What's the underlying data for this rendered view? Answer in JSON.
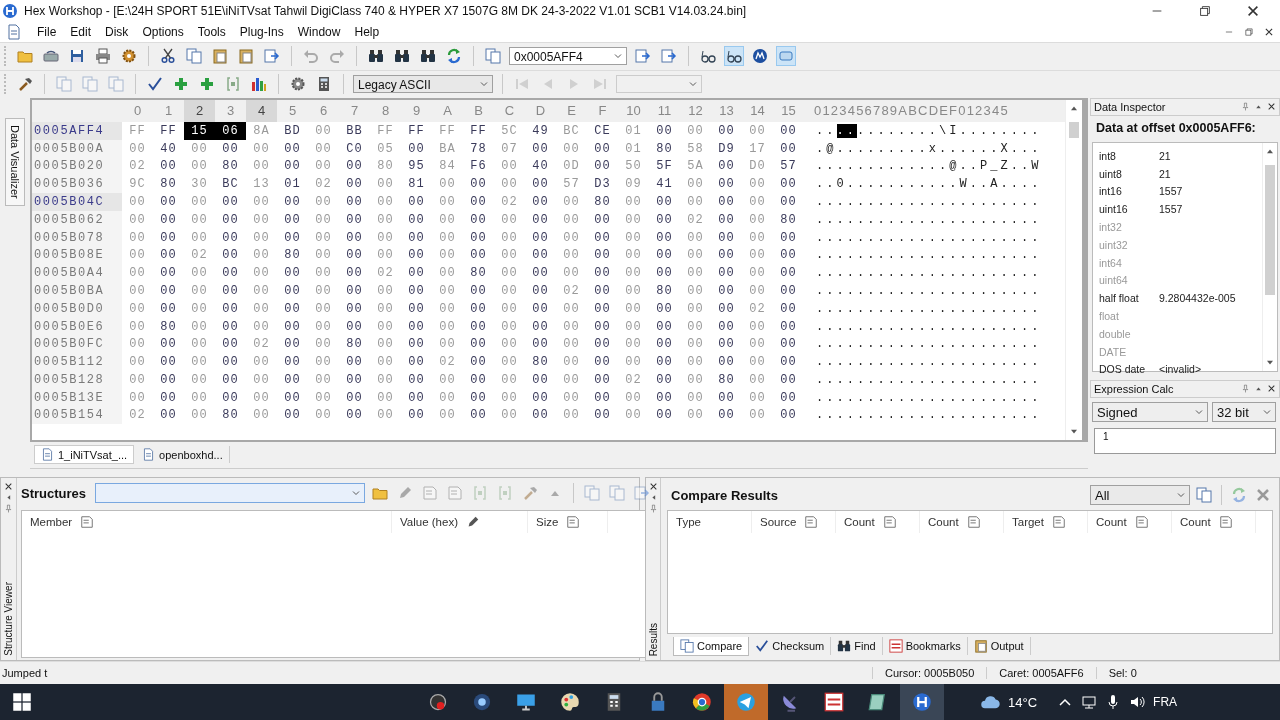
{
  "window": {
    "title": "Hex Workshop - [E:\\24H SPORT 51E\\iNiTVsat Tahwil DigiClass 740 & HYPER X7 1507G 8M DK 24-3-2022 V1.01 SCB1 V14.03.24.bin]"
  },
  "menu": [
    "File",
    "Edit",
    "Disk",
    "Options",
    "Tools",
    "Plug-Ins",
    "Window",
    "Help"
  ],
  "toolbar": {
    "address": "0x0005AFF4",
    "encoding": "Legacy ASCII"
  },
  "left_side_tab": "Data Visualizer",
  "hex_view": {
    "ascii_header": "0123456789ABCDEF012345",
    "columns": [
      {
        "label": "0",
        "highlighted": false
      },
      {
        "label": "1",
        "highlighted": false
      },
      {
        "label": "2",
        "highlighted": true
      },
      {
        "label": "3",
        "highlighted": false
      },
      {
        "label": "4",
        "highlighted": true
      },
      {
        "label": "5",
        "highlighted": false
      },
      {
        "label": "6",
        "highlighted": false
      },
      {
        "label": "7",
        "highlighted": false
      },
      {
        "label": "8",
        "highlighted": false
      },
      {
        "label": "9",
        "highlighted": false
      },
      {
        "label": "A",
        "highlighted": false
      },
      {
        "label": "B",
        "highlighted": false
      },
      {
        "label": "C",
        "highlighted": false
      },
      {
        "label": "D",
        "highlighted": false
      },
      {
        "label": "E",
        "highlighted": false
      },
      {
        "label": "F",
        "highlighted": false
      },
      {
        "label": "10",
        "highlighted": false
      },
      {
        "label": "11",
        "highlighted": false
      },
      {
        "label": "12",
        "highlighted": false
      },
      {
        "label": "13",
        "highlighted": false
      },
      {
        "label": "14",
        "highlighted": false
      },
      {
        "label": "15",
        "highlighted": false
      }
    ],
    "rows": [
      {
        "offset": "0005AFF4",
        "highlighted": true,
        "bytes": [
          "FF",
          "FF",
          "15",
          "06",
          "8A",
          "BD",
          "00",
          "BB",
          "FF",
          "FF",
          "FF",
          "FF",
          "5C",
          "49",
          "BC",
          "CE",
          "01",
          "00",
          "00",
          "00",
          "00",
          "00"
        ],
        "selected": [
          false,
          false,
          true,
          true,
          false,
          false,
          false,
          false,
          false,
          false,
          false,
          false,
          false,
          false,
          false,
          false,
          false,
          false,
          false,
          false,
          false,
          false
        ],
        "ascii": "............\\I........"
      },
      {
        "offset": "0005B00A",
        "highlighted": false,
        "bytes": [
          "00",
          "40",
          "00",
          "00",
          "00",
          "00",
          "00",
          "C0",
          "05",
          "00",
          "BA",
          "78",
          "07",
          "00",
          "00",
          "00",
          "01",
          "80",
          "58",
          "D9",
          "17",
          "00"
        ],
        "selected": [
          false,
          false,
          false,
          false,
          false,
          false,
          false,
          false,
          false,
          false,
          false,
          false,
          false,
          false,
          false,
          false,
          false,
          false,
          false,
          false,
          false,
          false
        ],
        "ascii": ".@.........x......X..."
      },
      {
        "offset": "0005B020",
        "highlighted": false,
        "bytes": [
          "02",
          "00",
          "00",
          "80",
          "00",
          "00",
          "00",
          "00",
          "80",
          "95",
          "84",
          "F6",
          "00",
          "40",
          "0D",
          "00",
          "50",
          "5F",
          "5A",
          "00",
          "D0",
          "57"
        ],
        "selected": [
          false,
          false,
          false,
          false,
          false,
          false,
          false,
          false,
          false,
          false,
          false,
          false,
          false,
          false,
          false,
          false,
          false,
          false,
          false,
          false,
          false,
          false
        ],
        "ascii": ".............@..P_Z..W"
      },
      {
        "offset": "0005B036",
        "highlighted": false,
        "bytes": [
          "9C",
          "80",
          "30",
          "BC",
          "13",
          "01",
          "02",
          "00",
          "00",
          "81",
          "00",
          "00",
          "00",
          "00",
          "57",
          "D3",
          "09",
          "41",
          "00",
          "00",
          "00",
          "00"
        ],
        "selected": [
          false,
          false,
          false,
          false,
          false,
          false,
          false,
          false,
          false,
          false,
          false,
          false,
          false,
          false,
          false,
          false,
          false,
          false,
          false,
          false,
          false,
          false
        ],
        "ascii": "..0...........W..A...."
      },
      {
        "offset": "0005B04C",
        "highlighted": true,
        "bytes": [
          "00",
          "00",
          "00",
          "00",
          "00",
          "00",
          "00",
          "00",
          "00",
          "00",
          "00",
          "00",
          "02",
          "00",
          "00",
          "80",
          "00",
          "00",
          "00",
          "00",
          "00",
          "00"
        ],
        "selected": [
          false,
          false,
          false,
          false,
          false,
          false,
          false,
          false,
          false,
          false,
          false,
          false,
          false,
          false,
          false,
          false,
          false,
          false,
          false,
          false,
          false,
          false
        ],
        "ascii": "......................"
      },
      {
        "offset": "0005B062",
        "highlighted": false,
        "bytes": [
          "00",
          "00",
          "00",
          "00",
          "00",
          "00",
          "00",
          "00",
          "00",
          "00",
          "00",
          "00",
          "00",
          "00",
          "00",
          "00",
          "00",
          "00",
          "02",
          "00",
          "00",
          "80"
        ],
        "selected": [
          false,
          false,
          false,
          false,
          false,
          false,
          false,
          false,
          false,
          false,
          false,
          false,
          false,
          false,
          false,
          false,
          false,
          false,
          false,
          false,
          false,
          false
        ],
        "ascii": "......................"
      },
      {
        "offset": "0005B078",
        "highlighted": false,
        "bytes": [
          "00",
          "00",
          "00",
          "00",
          "00",
          "00",
          "00",
          "00",
          "00",
          "00",
          "00",
          "00",
          "00",
          "00",
          "00",
          "00",
          "00",
          "00",
          "00",
          "00",
          "00",
          "00"
        ],
        "selected": [
          false,
          false,
          false,
          false,
          false,
          false,
          false,
          false,
          false,
          false,
          false,
          false,
          false,
          false,
          false,
          false,
          false,
          false,
          false,
          false,
          false,
          false
        ],
        "ascii": "......................"
      },
      {
        "offset": "0005B08E",
        "highlighted": false,
        "bytes": [
          "00",
          "00",
          "02",
          "00",
          "00",
          "80",
          "00",
          "00",
          "00",
          "00",
          "00",
          "00",
          "00",
          "00",
          "00",
          "00",
          "00",
          "00",
          "00",
          "00",
          "00",
          "00"
        ],
        "selected": [
          false,
          false,
          false,
          false,
          false,
          false,
          false,
          false,
          false,
          false,
          false,
          false,
          false,
          false,
          false,
          false,
          false,
          false,
          false,
          false,
          false,
          false
        ],
        "ascii": "......................"
      },
      {
        "offset": "0005B0A4",
        "highlighted": false,
        "bytes": [
          "00",
          "00",
          "00",
          "00",
          "00",
          "00",
          "00",
          "00",
          "02",
          "00",
          "00",
          "80",
          "00",
          "00",
          "00",
          "00",
          "00",
          "00",
          "00",
          "00",
          "00",
          "00"
        ],
        "selected": [
          false,
          false,
          false,
          false,
          false,
          false,
          false,
          false,
          false,
          false,
          false,
          false,
          false,
          false,
          false,
          false,
          false,
          false,
          false,
          false,
          false,
          false
        ],
        "ascii": "......................"
      },
      {
        "offset": "0005B0BA",
        "highlighted": false,
        "bytes": [
          "00",
          "00",
          "00",
          "00",
          "00",
          "00",
          "00",
          "00",
          "00",
          "00",
          "00",
          "00",
          "00",
          "00",
          "02",
          "00",
          "00",
          "80",
          "00",
          "00",
          "00",
          "00"
        ],
        "selected": [
          false,
          false,
          false,
          false,
          false,
          false,
          false,
          false,
          false,
          false,
          false,
          false,
          false,
          false,
          false,
          false,
          false,
          false,
          false,
          false,
          false,
          false
        ],
        "ascii": "......................"
      },
      {
        "offset": "0005B0D0",
        "highlighted": false,
        "bytes": [
          "00",
          "00",
          "00",
          "00",
          "00",
          "00",
          "00",
          "00",
          "00",
          "00",
          "00",
          "00",
          "00",
          "00",
          "00",
          "00",
          "00",
          "00",
          "00",
          "00",
          "02",
          "00"
        ],
        "selected": [
          false,
          false,
          false,
          false,
          false,
          false,
          false,
          false,
          false,
          false,
          false,
          false,
          false,
          false,
          false,
          false,
          false,
          false,
          false,
          false,
          false,
          false
        ],
        "ascii": "......................"
      },
      {
        "offset": "0005B0E6",
        "highlighted": false,
        "bytes": [
          "00",
          "80",
          "00",
          "00",
          "00",
          "00",
          "00",
          "00",
          "00",
          "00",
          "00",
          "00",
          "00",
          "00",
          "00",
          "00",
          "00",
          "00",
          "00",
          "00",
          "00",
          "00"
        ],
        "selected": [
          false,
          false,
          false,
          false,
          false,
          false,
          false,
          false,
          false,
          false,
          false,
          false,
          false,
          false,
          false,
          false,
          false,
          false,
          false,
          false,
          false,
          false
        ],
        "ascii": "......................"
      },
      {
        "offset": "0005B0FC",
        "highlighted": false,
        "bytes": [
          "00",
          "00",
          "00",
          "00",
          "02",
          "00",
          "00",
          "80",
          "00",
          "00",
          "00",
          "00",
          "00",
          "00",
          "00",
          "00",
          "00",
          "00",
          "00",
          "00",
          "00",
          "00"
        ],
        "selected": [
          false,
          false,
          false,
          false,
          false,
          false,
          false,
          false,
          false,
          false,
          false,
          false,
          false,
          false,
          false,
          false,
          false,
          false,
          false,
          false,
          false,
          false
        ],
        "ascii": "......................"
      },
      {
        "offset": "0005B112",
        "highlighted": false,
        "bytes": [
          "00",
          "00",
          "00",
          "00",
          "00",
          "00",
          "00",
          "00",
          "00",
          "00",
          "02",
          "00",
          "00",
          "80",
          "00",
          "00",
          "00",
          "00",
          "00",
          "00",
          "00",
          "00"
        ],
        "selected": [
          false,
          false,
          false,
          false,
          false,
          false,
          false,
          false,
          false,
          false,
          false,
          false,
          false,
          false,
          false,
          false,
          false,
          false,
          false,
          false,
          false,
          false
        ],
        "ascii": "......................"
      },
      {
        "offset": "0005B128",
        "highlighted": false,
        "bytes": [
          "00",
          "00",
          "00",
          "00",
          "00",
          "00",
          "00",
          "00",
          "00",
          "00",
          "00",
          "00",
          "00",
          "00",
          "00",
          "00",
          "02",
          "00",
          "00",
          "80",
          "00",
          "00"
        ],
        "selected": [
          false,
          false,
          false,
          false,
          false,
          false,
          false,
          false,
          false,
          false,
          false,
          false,
          false,
          false,
          false,
          false,
          false,
          false,
          false,
          false,
          false,
          false
        ],
        "ascii": "......................"
      },
      {
        "offset": "0005B13E",
        "highlighted": false,
        "bytes": [
          "00",
          "00",
          "00",
          "00",
          "00",
          "00",
          "00",
          "00",
          "00",
          "00",
          "00",
          "00",
          "00",
          "00",
          "00",
          "00",
          "00",
          "00",
          "00",
          "00",
          "00",
          "00"
        ],
        "selected": [
          false,
          false,
          false,
          false,
          false,
          false,
          false,
          false,
          false,
          false,
          false,
          false,
          false,
          false,
          false,
          false,
          false,
          false,
          false,
          false,
          false,
          false
        ],
        "ascii": "......................"
      },
      {
        "offset": "0005B154",
        "highlighted": false,
        "bytes": [
          "02",
          "00",
          "00",
          "80",
          "00",
          "00",
          "00",
          "00",
          "00",
          "00",
          "00",
          "00",
          "00",
          "00",
          "00",
          "00",
          "00",
          "00",
          "00",
          "00",
          "00",
          "00"
        ],
        "selected": [
          false,
          false,
          false,
          false,
          false,
          false,
          false,
          false,
          false,
          false,
          false,
          false,
          false,
          false,
          false,
          false,
          false,
          false,
          false,
          false,
          false,
          false
        ],
        "ascii": "......................"
      }
    ]
  },
  "document_tabs": [
    {
      "label": "1_iNiTVsat_...",
      "selected": true
    },
    {
      "label": "openboxhd...",
      "selected": false
    }
  ],
  "data_inspector": {
    "title": "Data Inspector",
    "heading": "Data at offset 0x0005AFF6:",
    "rows": [
      {
        "type": "int8",
        "value": "21",
        "disabled": false
      },
      {
        "type": "uint8",
        "value": "21",
        "disabled": false
      },
      {
        "type": "int16",
        "value": "1557",
        "disabled": false
      },
      {
        "type": "uint16",
        "value": "1557",
        "disabled": false
      },
      {
        "type": "int32",
        "disabled": true
      },
      {
        "type": "uint32",
        "disabled": true
      },
      {
        "type": "int64",
        "disabled": true
      },
      {
        "type": "uint64",
        "disabled": true
      },
      {
        "type": "half float",
        "value": "9.2804432e-005",
        "disabled": false
      },
      {
        "type": "float",
        "disabled": true
      },
      {
        "type": "double",
        "disabled": true
      },
      {
        "type": "DATE",
        "disabled": true
      },
      {
        "type": "DOS date",
        "value": "<invalid>",
        "disabled": false
      }
    ]
  },
  "expression_calc": {
    "title": "Expression Calc",
    "mode": "Signed",
    "width": "32 bit",
    "expression": "1"
  },
  "structures": {
    "title": "Structures",
    "side_label": "Structure Viewer",
    "columns": [
      "Member",
      "Value (hex)",
      "Size"
    ]
  },
  "compare_results": {
    "title": "Compare Results",
    "side_label": "Results",
    "filter": "All",
    "columns": [
      "Type",
      "Source",
      "Count",
      "Count",
      "Target",
      "Count",
      "Count"
    ],
    "tabs": [
      {
        "label": "Compare",
        "selected": true
      },
      {
        "label": "Checksum",
        "selected": false
      },
      {
        "label": "Find",
        "selected": false
      },
      {
        "label": "Bookmarks",
        "selected": false
      },
      {
        "label": "Output",
        "selected": false
      }
    ]
  },
  "status_bar": {
    "message": "Jumped t",
    "cursor": "Cursor: 0005B050",
    "caret": "Caret: 0005AFF6",
    "selection": "Sel: 0"
  },
  "taskbar": {
    "weather": "14°C",
    "language": "FRA"
  }
}
